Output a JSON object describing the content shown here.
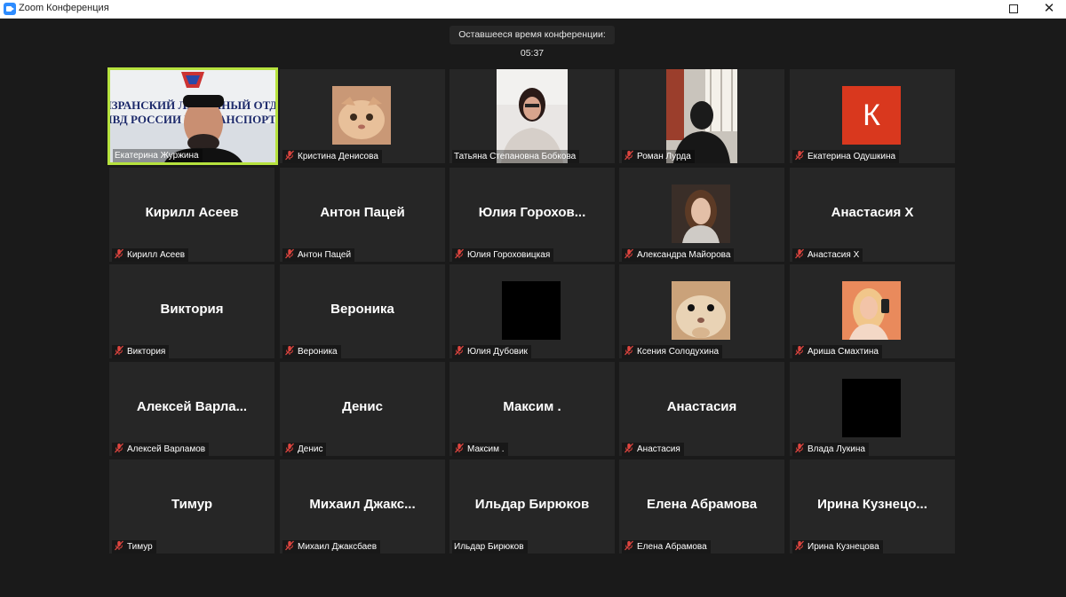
{
  "window": {
    "title": "Zoom Конференция",
    "icon": "zoom-camera-icon",
    "maximize_icon": "maximize-icon",
    "close_icon": "close-icon",
    "close_glyph": "✕"
  },
  "timer_text": "Оставшееся время конференции: 05:37",
  "colors": {
    "background": "#1a1a1a",
    "tile": "#262626",
    "active_speaker_border": "#b6e23e",
    "muted_mic": "#e0453f",
    "avatar_k": "#d9381e"
  },
  "participants": [
    {
      "label": "Екатерина Журжина",
      "type": "video-speaker",
      "banner_line1": "СЫЗРАНСКИЙ ЛИНЕЙНЫЙ ОТДЕЛ",
      "banner_line2": "МВД РОССИИ НА ТРАНСПОРТЕ",
      "muted": false
    },
    {
      "label": "Кристина Денисова",
      "type": "avatar-cat",
      "muted": true
    },
    {
      "label": "Татьяна Степановна Бобкова",
      "type": "video-woman",
      "muted": false
    },
    {
      "label": "Роман Лурда",
      "type": "video-man",
      "muted": true
    },
    {
      "label": "Екатерина Одушкина",
      "type": "avatar-letter",
      "letter": "К",
      "muted": true
    },
    {
      "label": "Кирилл Асеев",
      "big": "Кирилл Асеев",
      "type": "name",
      "muted": true
    },
    {
      "label": "Антон Пацей",
      "big": "Антон Пацей",
      "type": "name",
      "muted": true
    },
    {
      "label": "Юлия Гороховицкая",
      "big": "Юлия Горохов...",
      "type": "name",
      "muted": true
    },
    {
      "label": "Александра Майорова",
      "type": "avatar-photo-girl",
      "muted": true
    },
    {
      "label": "Анастасия Х",
      "big": "Анастасия Х",
      "type": "name",
      "muted": true
    },
    {
      "label": "Виктория",
      "big": "Виктория",
      "type": "name",
      "muted": true
    },
    {
      "label": "Вероника",
      "big": "Вероника",
      "type": "name",
      "muted": true
    },
    {
      "label": "Юлия Дубовик",
      "type": "avatar-black",
      "muted": true
    },
    {
      "label": "Ксения Солодухина",
      "type": "avatar-hamster",
      "muted": true
    },
    {
      "label": "Ариша Смахтина",
      "type": "avatar-photo-blonde",
      "muted": true
    },
    {
      "label": "Алексей Варламов",
      "big": "Алексей  Варла...",
      "type": "name",
      "muted": true
    },
    {
      "label": "Денис",
      "big": "Денис",
      "type": "name",
      "muted": true
    },
    {
      "label": "Максим .",
      "big": "Максим .",
      "type": "name",
      "muted": true
    },
    {
      "label": "Анастасия",
      "big": "Анастасия",
      "type": "name",
      "muted": true
    },
    {
      "label": "Влада Лукина",
      "type": "avatar-black",
      "muted": true
    },
    {
      "label": "Тимур",
      "big": "Тимур",
      "type": "name",
      "muted": true
    },
    {
      "label": "Михаил Джаксбаев",
      "big": "Михаил  Джакс...",
      "type": "name",
      "muted": true
    },
    {
      "label": "Ильдар Бирюков",
      "big": "Ильдар Бирюков",
      "type": "name",
      "muted": false
    },
    {
      "label": "Елена Абрамова",
      "big": "Елена Абрамова",
      "type": "name",
      "muted": true
    },
    {
      "label": "Ирина Кузнецова",
      "big": "Ирина  Кузнецо...",
      "type": "name",
      "muted": true
    }
  ]
}
